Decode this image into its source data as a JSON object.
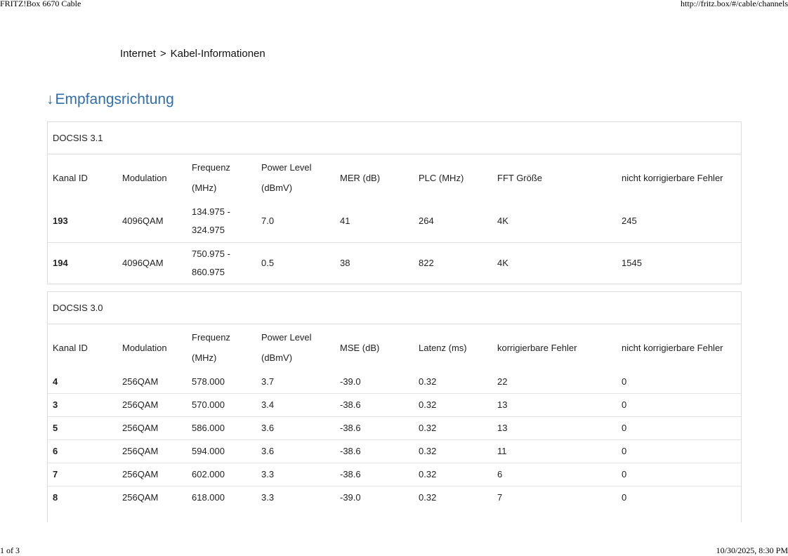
{
  "print_header": {
    "title": "FRITZ!Box 6670 Cable",
    "url": "http://fritz.box/#/cable/channels"
  },
  "print_footer": {
    "page": "1 of 3",
    "datetime": "10/30/2025, 8:30 PM"
  },
  "breadcrumb": {
    "item1": "Internet",
    "separator": ">",
    "item2": "Kabel-Informationen"
  },
  "section": {
    "arrow": "↓",
    "title": "Empfangsrichtung"
  },
  "docsis31": {
    "title": "DOCSIS 3.1",
    "headers": [
      "Kanal ID",
      "Modulation",
      "Frequenz (MHz)",
      "Power Level (dBmV)",
      "MER (dB)",
      "PLC (MHz)",
      "FFT Größe",
      "nicht korrigierbare Fehler"
    ],
    "rows": [
      [
        "193",
        "4096QAM",
        "134.975 - 324.975",
        "7.0",
        "41",
        "264",
        "4K",
        "245"
      ],
      [
        "194",
        "4096QAM",
        "750.975 - 860.975",
        "0.5",
        "38",
        "822",
        "4K",
        "1545"
      ]
    ]
  },
  "docsis30": {
    "title": "DOCSIS 3.0",
    "headers": [
      "Kanal ID",
      "Modulation",
      "Frequenz (MHz)",
      "Power Level (dBmV)",
      "MSE (dB)",
      "Latenz (ms)",
      "korrigierbare Fehler",
      "nicht korrigierbare Fehler"
    ],
    "rows": [
      [
        "4",
        "256QAM",
        "578.000",
        "3.7",
        "-39.0",
        "0.32",
        "22",
        "0"
      ],
      [
        "3",
        "256QAM",
        "570.000",
        "3.4",
        "-38.6",
        "0.32",
        "13",
        "0"
      ],
      [
        "5",
        "256QAM",
        "586.000",
        "3.6",
        "-38.6",
        "0.32",
        "13",
        "0"
      ],
      [
        "6",
        "256QAM",
        "594.000",
        "3.6",
        "-38.6",
        "0.32",
        "11",
        "0"
      ],
      [
        "7",
        "256QAM",
        "602.000",
        "3.3",
        "-38.6",
        "0.32",
        "6",
        "0"
      ],
      [
        "8",
        "256QAM",
        "618.000",
        "3.3",
        "-39.0",
        "0.32",
        "7",
        "0"
      ]
    ]
  }
}
